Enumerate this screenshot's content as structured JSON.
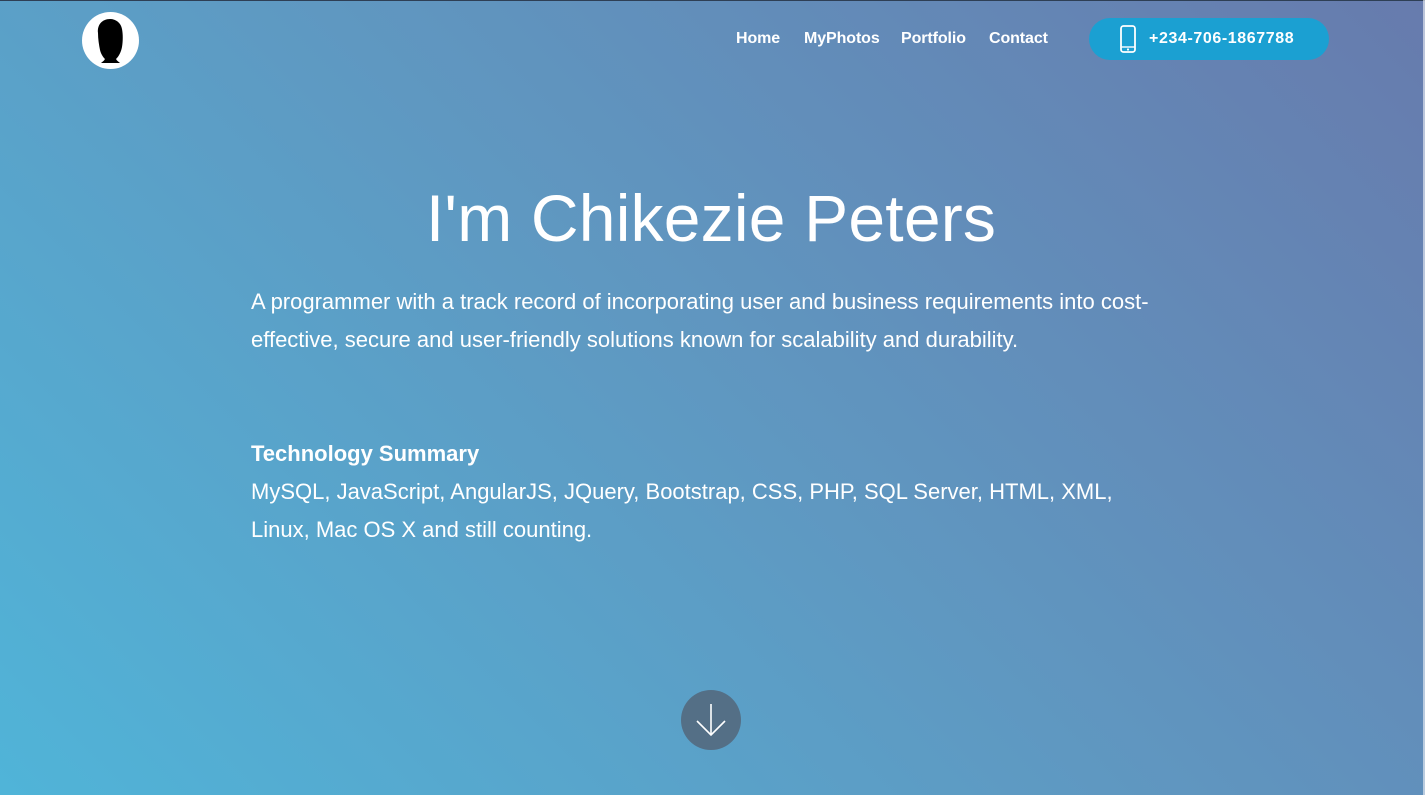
{
  "header": {
    "logo": {
      "icon": "silhouette-icon"
    },
    "nav": [
      {
        "label": "Home"
      },
      {
        "label": "MyPhotos"
      },
      {
        "label": "Portfolio"
      },
      {
        "label": "Contact"
      }
    ],
    "phone": {
      "icon": "mobile-phone-icon",
      "label": "+234-706-1867788"
    }
  },
  "hero": {
    "title": "I'm Chikezie Peters",
    "intro": "A programmer with a track record of incorporating user and business requirements into cost-effective, secure and user-friendly solutions known for scalability and durability.",
    "tech_heading": "Technology Summary",
    "tech_list": "MySQL, JavaScript, AngularJS, JQuery, Bootstrap, CSS, PHP, SQL Server, HTML, XML, Linux, Mac OS X and still counting.",
    "scroll_icon": "arrow-down-icon"
  },
  "colors": {
    "gradient_start": "#50b4d8",
    "gradient_end": "#677bad",
    "phone_button": "#1ba0d2",
    "scroll_button": "#546f86",
    "text": "#ffffff"
  }
}
